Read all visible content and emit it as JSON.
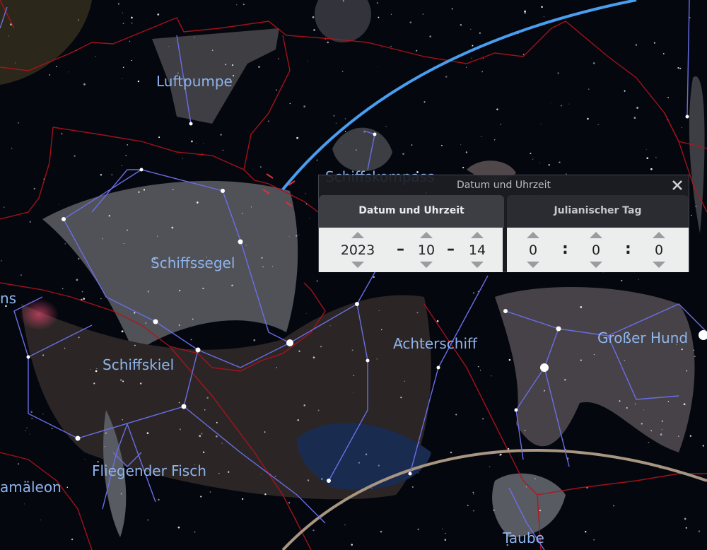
{
  "constellations": {
    "luftpumpe": "Luftpumpe",
    "schiffskompass": "Schiffskompass",
    "schiffssegel": "Schiffssegel",
    "schiffskiel": "Schiffskiel",
    "achterschiff": "Achterschiff",
    "grosser_hund": "Großer Hund",
    "fliegender_fisch": "Fliegender Fisch",
    "chamaeleon": "amäleon",
    "taube": "Taube",
    "partial_left": "ns"
  },
  "dialog": {
    "title": "Datum und Uhrzeit",
    "close_icon": "close-icon",
    "tabs": [
      {
        "label": "Datum und Uhrzeit",
        "active": true
      },
      {
        "label": "Julianischer Tag",
        "active": false
      }
    ],
    "date": {
      "year": "2023",
      "month": "10",
      "day": "14",
      "separator": "–"
    },
    "time": {
      "hour": "0",
      "minute": "0",
      "second": "0",
      "separator": ":"
    }
  },
  "colors": {
    "background": "#05070f",
    "constellation_lines": "#6a6ee6",
    "boundaries": "#b3121b",
    "ecliptic": "#4a9ef0",
    "horizon_arc": "#a89682",
    "label": "#8fb4ec"
  }
}
